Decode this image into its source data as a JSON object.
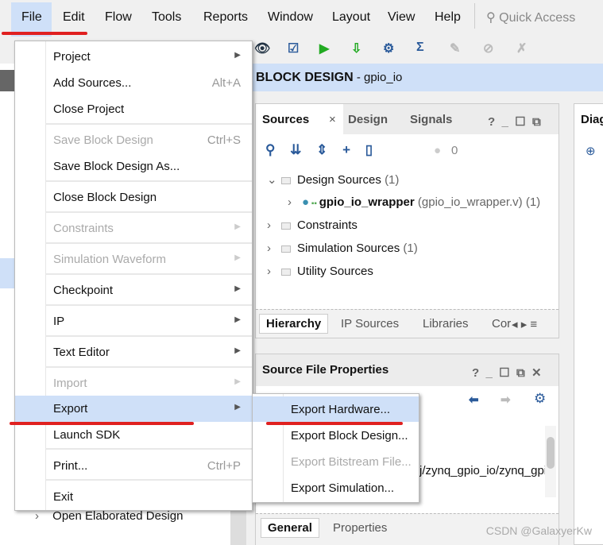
{
  "menubar": {
    "items": [
      "File",
      "Edit",
      "Flow",
      "Tools",
      "Reports",
      "Window",
      "Layout",
      "View",
      "Help"
    ],
    "quick_access_placeholder": "Quick Access"
  },
  "banner": {
    "title": "BLOCK DESIGN",
    "subtitle": " - gpio_io"
  },
  "left": {
    "open_elaborated": "Open Elaborated Design"
  },
  "sources_panel": {
    "tabs": [
      "Sources",
      "Design",
      "Signals"
    ],
    "count": "0",
    "tree": [
      {
        "label": "Design Sources",
        "count": "(1)"
      },
      {
        "label": "gpio_io_wrapper",
        "file": "(gpio_io_wrapper.v)",
        "count": "(1)"
      },
      {
        "label": "Constraints",
        "count": ""
      },
      {
        "label": "Simulation Sources",
        "count": "(1)"
      },
      {
        "label": "Utility Sources",
        "count": ""
      }
    ],
    "bottom_tabs": [
      "Hierarchy",
      "IP Sources",
      "Libraries",
      "Cor"
    ]
  },
  "props_panel": {
    "title": "Source File Properties",
    "path": "j/zynq_gpio_io/zynq_gpi",
    "bottom_tabs": [
      "General",
      "Properties"
    ]
  },
  "diagram_tab": "Diag",
  "file_menu": {
    "items": [
      {
        "label": "Project",
        "submenu": true
      },
      {
        "label": "Add Sources...",
        "shortcut": "Alt+A"
      },
      {
        "label": "Close Project"
      },
      {
        "label": "Save Block Design",
        "shortcut": "Ctrl+S",
        "disabled": true
      },
      {
        "label": "Save Block Design As..."
      },
      {
        "label": "Close Block Design"
      },
      {
        "label": "Constraints",
        "submenu": true,
        "disabled": true
      },
      {
        "label": "Simulation Waveform",
        "submenu": true,
        "disabled": true
      },
      {
        "label": "Checkpoint",
        "submenu": true
      },
      {
        "label": "IP",
        "submenu": true
      },
      {
        "label": "Text Editor",
        "submenu": true
      },
      {
        "label": "Import",
        "submenu": true,
        "disabled": true
      },
      {
        "label": "Export",
        "submenu": true,
        "highlighted": true
      },
      {
        "label": "Launch SDK"
      },
      {
        "label": "Print...",
        "shortcut": "Ctrl+P"
      },
      {
        "label": "Exit"
      }
    ]
  },
  "export_submenu": {
    "items": [
      {
        "label": "Export Hardware...",
        "highlighted": true
      },
      {
        "label": "Export Block Design..."
      },
      {
        "label": "Export Bitstream File...",
        "disabled": true
      },
      {
        "label": "Export Simulation..."
      }
    ]
  },
  "watermark": "CSDN @GalaxyerKw",
  "colors": {
    "highlight": "#cfe0f8",
    "annotation_red": "#e02020"
  }
}
